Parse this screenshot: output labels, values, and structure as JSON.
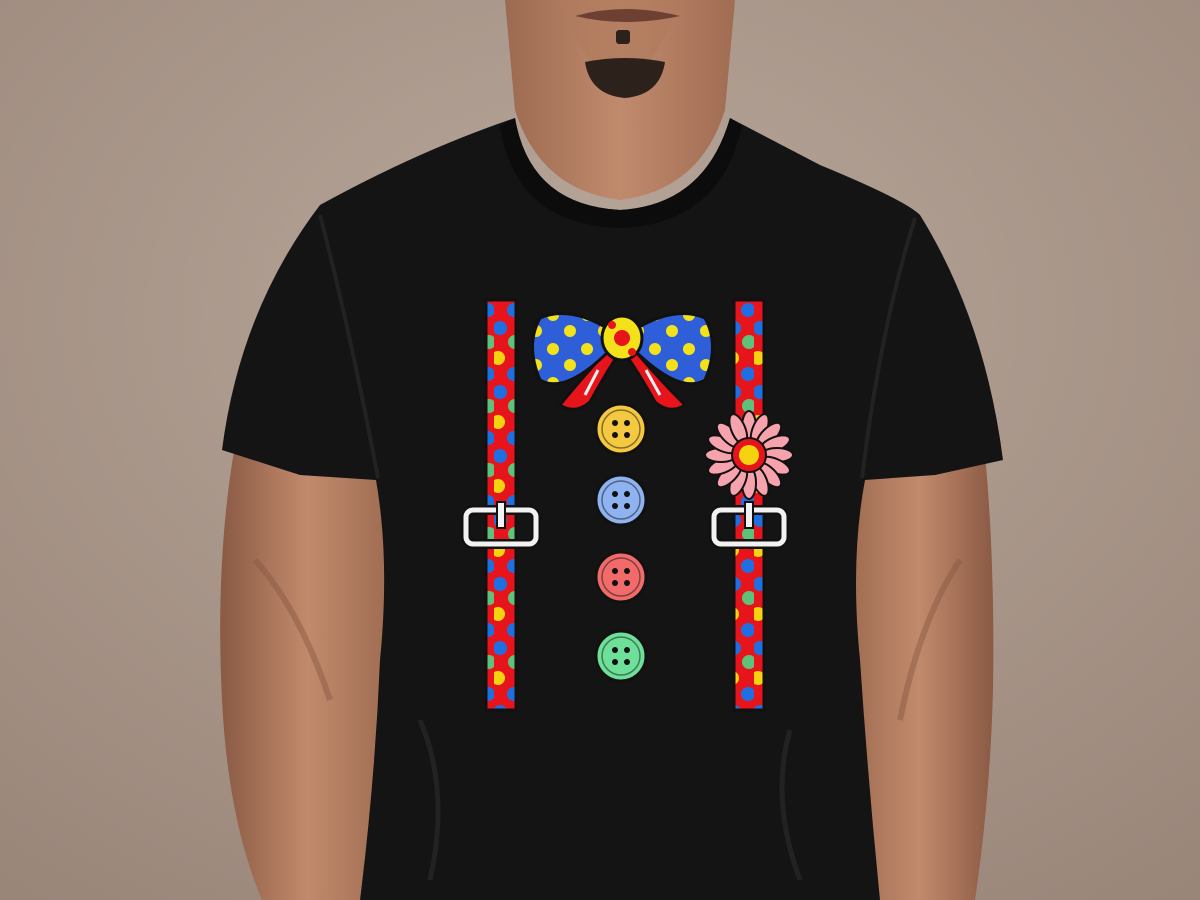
{
  "image": {
    "subject": "man-wearing-clown-print-tshirt",
    "colors": {
      "background": "#a59184",
      "background_light": "#b8a79b",
      "skin": "#b47f63",
      "skin_shadow": "#8a5a44",
      "skin_highlight": "#c9957a",
      "shirt": "#141414",
      "shirt_fold": "#222222",
      "suspender_red": "#e8141b",
      "dot_blue": "#1f6fe0",
      "dot_yellow": "#f5d40f",
      "dot_green": "#5ec27a",
      "bow_blue": "#2f5fd8",
      "bow_yellow": "#f3e21a",
      "knot_red": "#e8141b",
      "clip_fill": "#f2f2f2",
      "flower_pink": "#f7a3ad",
      "flower_center_red": "#e8141b",
      "flower_center_yellow": "#f5d40f"
    },
    "buttons": [
      {
        "color": "yellow",
        "fill": "#f5c842"
      },
      {
        "color": "blue",
        "fill": "#8fb3f0"
      },
      {
        "color": "red",
        "fill": "#f26b6b"
      },
      {
        "color": "green",
        "fill": "#6fe09a"
      }
    ],
    "icons": [
      "bow-tie-icon",
      "flower-icon",
      "suspender-clip-icon",
      "button-icon"
    ]
  }
}
